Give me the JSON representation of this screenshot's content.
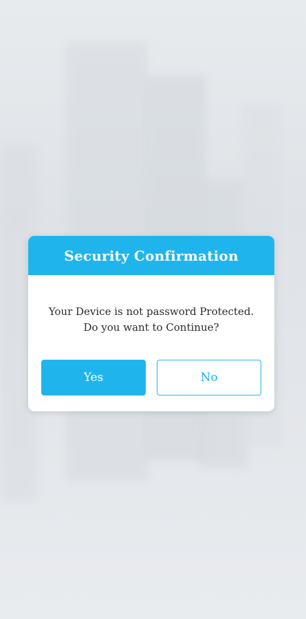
{
  "dialog": {
    "title": "Security Confirmation",
    "message_line1": "Your Device is not password Protected.",
    "message_line2": "Do you want to Continue?",
    "yes_label": "Yes",
    "no_label": "No"
  },
  "colors": {
    "accent": "#1fb5ec",
    "background": "#e3e6ea",
    "dialog_bg": "#ffffff",
    "message_text": "#2b2b2b"
  }
}
